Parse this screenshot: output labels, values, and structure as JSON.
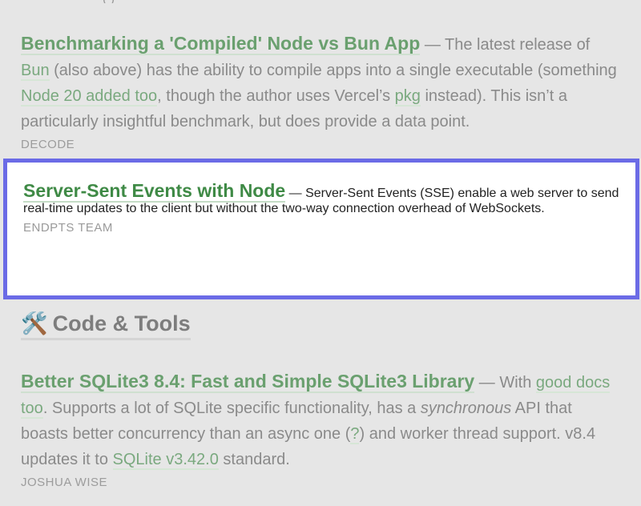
{
  "top_fragment": "(         )",
  "items": [
    {
      "title": "Benchmarking a 'Compiled' Node vs Bun App",
      "dash": " — ",
      "t1": "The latest release of ",
      "l1": "Bun",
      "t2": " (also above) has the ability to compile apps into a single executable (something ",
      "l2": "Node 20 added too",
      "t3": ", though the author uses Vercel’s ",
      "l3": "pkg",
      "t4": " instead). This isn’t a particularly insightful benchmark, but does provide a data point.",
      "source": "DECODE"
    },
    {
      "title": "Server-Sent Events with Node",
      "dash": " — ",
      "t1": "Server-Sent Events (SSE) enable a web server to send real-time updates to the client but without the two-way connection overhead of WebSockets.",
      "source": "ENDPTS TEAM"
    },
    {
      "title": "Better SQLite3 8.4: Fast and Simple SQLite3 Library",
      "dash": " — ",
      "t1": "With ",
      "l1": "good docs too",
      "t2": ". Supports a lot of SQLite specific functionality, has a ",
      "em": "synchronous",
      "t3": " API that boasts better concurrency than an async one (",
      "l2": "?",
      "t4": ") and worker thread support. v8.4 updates it to ",
      "l3": "SQLite v3.42.0",
      "t5": " standard.",
      "source": "JOSHUA WISE"
    }
  ],
  "section": {
    "icon": "🛠️",
    "title": "Code & Tools"
  }
}
